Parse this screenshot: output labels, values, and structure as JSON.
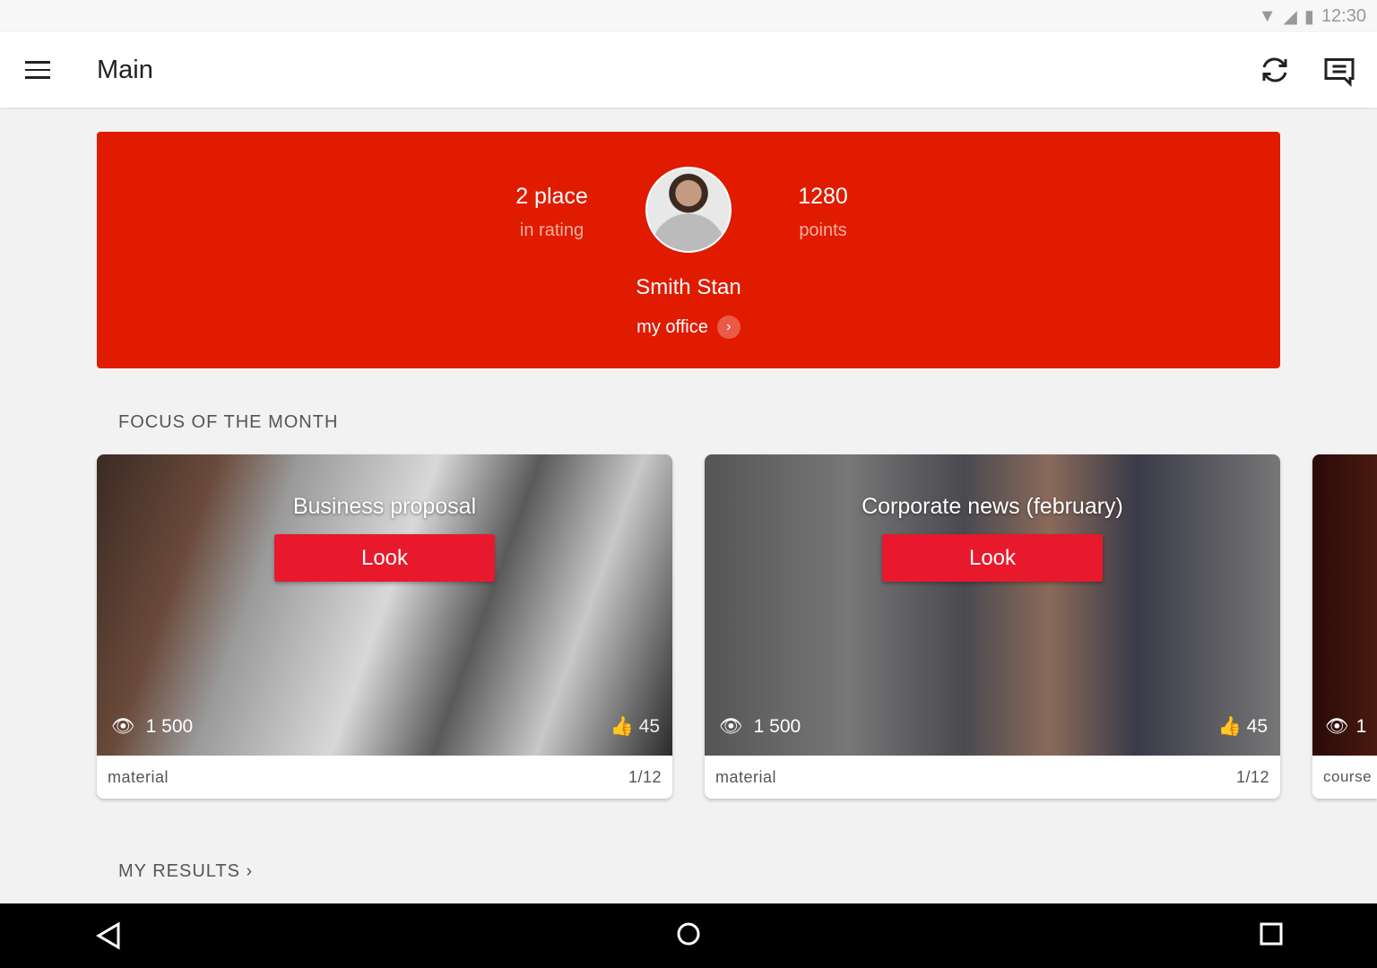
{
  "status": {
    "time": "12:30",
    "icons": [
      "wifi-icon",
      "signal-icon",
      "battery-icon"
    ]
  },
  "appbar": {
    "title": "Main",
    "icons": [
      "menu-icon",
      "refresh-icon",
      "message-icon"
    ]
  },
  "profile": {
    "place": "2 place",
    "place_label": "in rating",
    "points": "1280",
    "points_label": "points",
    "name": "Smith Stan",
    "office_link": "my office"
  },
  "sections": {
    "focus": "FOCUS OF THE MONTH",
    "results": "MY RESULTS"
  },
  "cards": [
    {
      "title": "Business proposal",
      "button": "Look",
      "views": "1 500",
      "likes": "45",
      "type": "material",
      "page": "1/12"
    },
    {
      "title": "Corporate news (february)",
      "button": "Look",
      "views": "1 500",
      "likes": "45",
      "type": "material",
      "page": "1/12"
    },
    {
      "views": "1",
      "type": "course"
    }
  ],
  "colors": {
    "accent": "#e01b00",
    "button": "#e8192c"
  }
}
